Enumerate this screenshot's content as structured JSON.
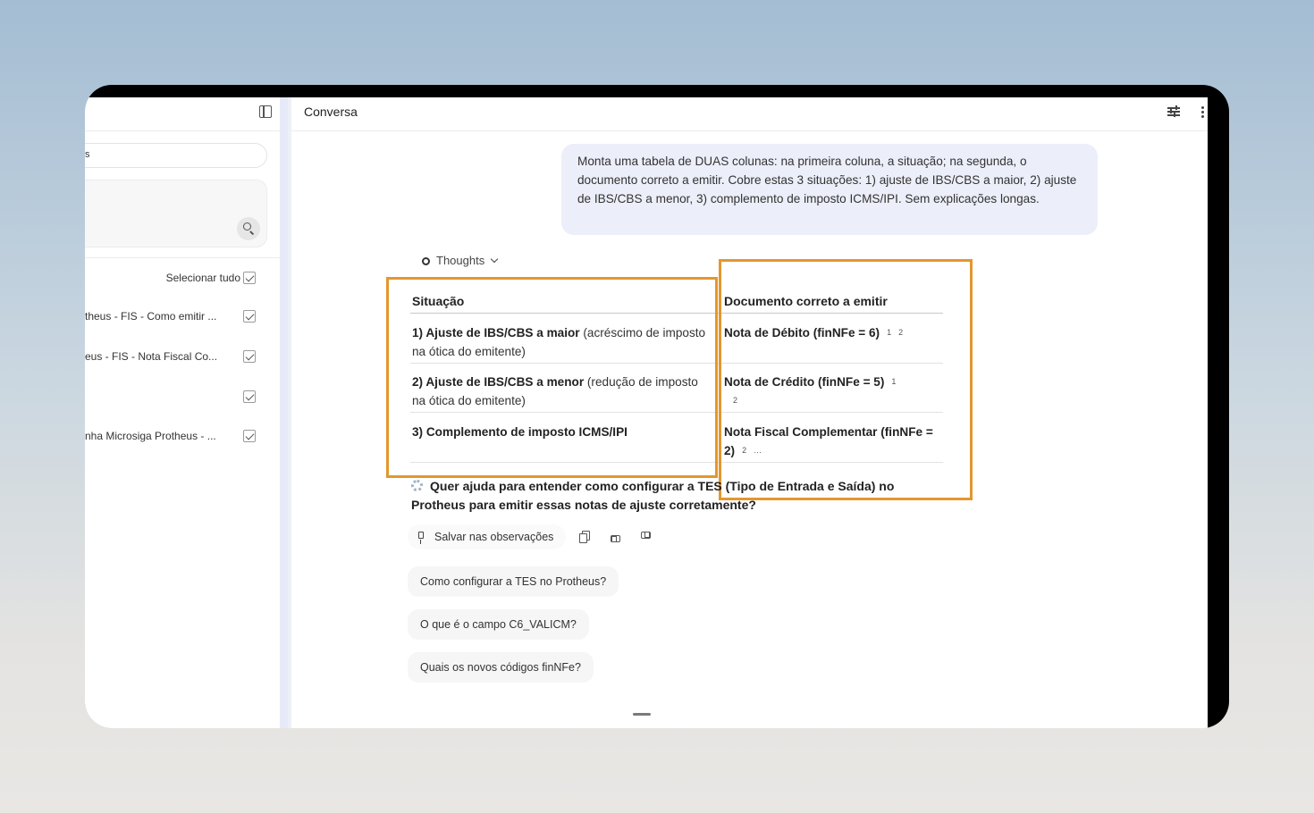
{
  "sidebar": {
    "search_text": "s",
    "select_all_label": "Selecionar tudo",
    "sources": [
      {
        "label": "theus - FIS - Como emitir ...",
        "checked": true
      },
      {
        "label": "eus - FIS - Nota Fiscal Co...",
        "checked": true
      },
      {
        "label": "",
        "checked": true
      },
      {
        "label": "nha Microsiga Protheus - ...",
        "checked": true
      }
    ]
  },
  "header": {
    "title": "Conversa",
    "icons": [
      "tune-icon",
      "more-vert-icon"
    ]
  },
  "chat": {
    "user_message": "Monta uma tabela de DUAS colunas: na primeira coluna, a situação; na segunda, o documento correto a emitir. Cobre estas 3 situações: 1) ajuste de IBS/CBS a maior, 2) ajuste de IBS/CBS a menor, 3) complemento de imposto ICMS/IPI. Sem explicações longas.",
    "thoughts_label": "Thoughts",
    "table": {
      "headers": [
        "Situação",
        "Documento correto a emitir"
      ],
      "rows": [
        {
          "sit_bold": "1) Ajuste de IBS/CBS a maior",
          "sit_rest": " (acréscimo de imposto na ótica do emitente)",
          "doc": "Nota de Débito (finNFe = 6)",
          "cites": [
            "1",
            "2"
          ]
        },
        {
          "sit_bold": "2) Ajuste de IBS/CBS a menor",
          "sit_rest": " (redução de imposto na ótica do emitente)",
          "doc": "Nota de Crédito (finNFe = 5)",
          "cites": [
            "1",
            "2"
          ]
        },
        {
          "sit_bold": "3) Complemento de imposto ICMS/IPI",
          "sit_rest": "",
          "doc": "Nota Fiscal Complementar (finNFe = 2)",
          "cites": [
            "2",
            "…"
          ]
        }
      ]
    },
    "followup_question": "Quer ajuda para entender como configurar a TES (Tipo de Entrada e Saída) no Protheus para emitir essas notas de ajuste corretamente?",
    "save_label": "Salvar nas observações",
    "suggestions": [
      "Como configurar a TES no Protheus?",
      "O que é o campo C6_VALICM?",
      "Quais os novos códigos finNFe?"
    ]
  },
  "colors": {
    "highlight": "#e3972e",
    "user_bubble": "#eceef9"
  }
}
